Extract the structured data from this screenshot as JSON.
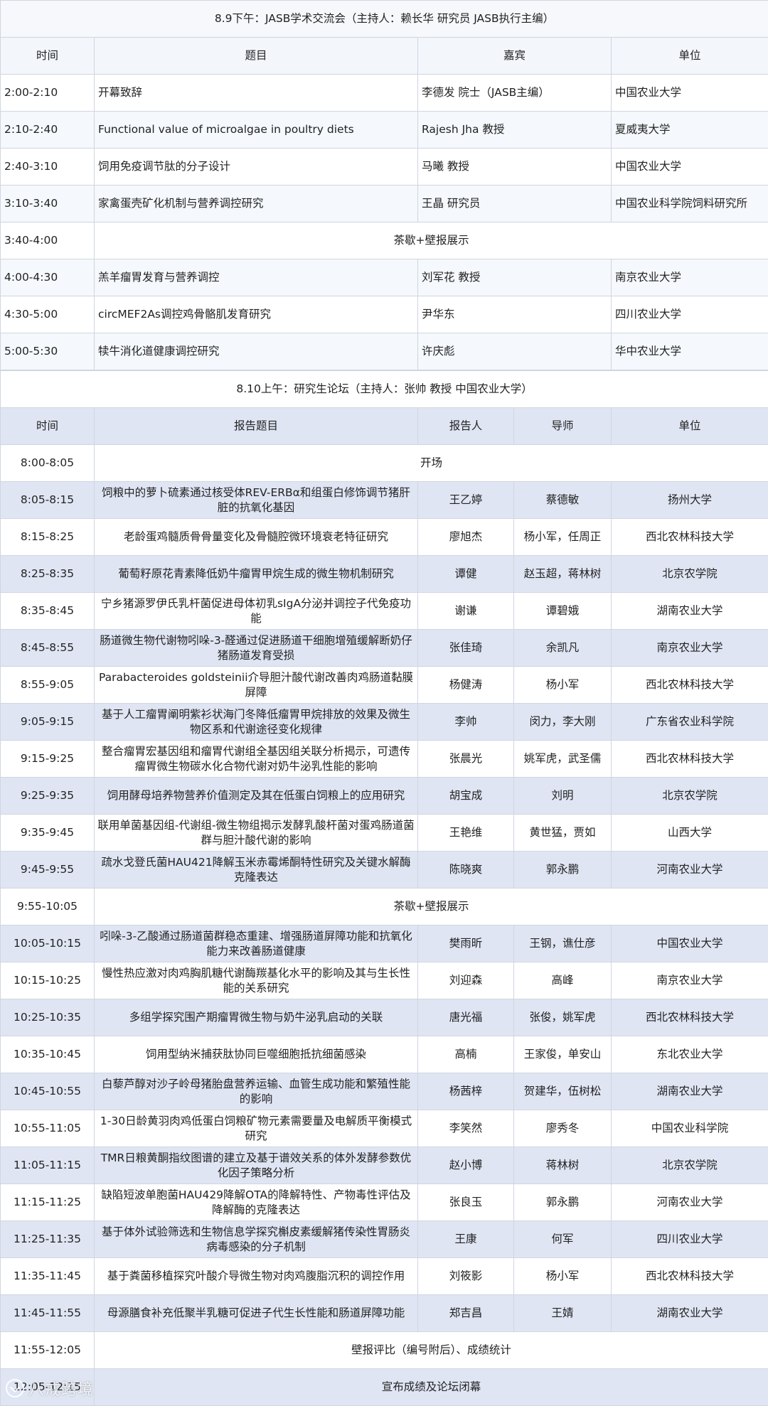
{
  "session1": {
    "title": "8.9下午：JASB学术交流会（主持人：赖长华  研究员 JASB执行主编）",
    "headers": {
      "time": "时间",
      "topic": "题目",
      "guest": "嘉宾",
      "unit": "单位"
    },
    "rows": [
      {
        "time": "2:00-2:10",
        "topic": "开幕致辞",
        "guest": "李德发 院士（JASB主编）",
        "unit": "中国农业大学"
      },
      {
        "time": "2:10-2:40",
        "topic": "Functional value of microalgae in poultry diets",
        "guest": "Rajesh Jha 教授",
        "unit": "夏威夷大学"
      },
      {
        "time": "2:40-3:10",
        "topic": "饲用免疫调节肽的分子设计",
        "guest": "马曦 教授",
        "unit": "中国农业大学"
      },
      {
        "time": "3:10-3:40",
        "topic": "家禽蛋壳矿化机制与营养调控研究",
        "guest": "王晶 研究员",
        "unit": "中国农业科学院饲料研究所"
      },
      {
        "time": "3:40-4:00",
        "break": "茶歇+壁报展示"
      },
      {
        "time": "4:00-4:30",
        "topic": "羔羊瘤胃发育与营养调控",
        "guest": "刘军花 教授",
        "unit": "南京农业大学"
      },
      {
        "time": "4:30-5:00",
        "topic": "circMEF2As调控鸡骨骼肌发育研究",
        "guest": "尹华东",
        "unit": "四川农业大学"
      },
      {
        "time": "5:00-5:30",
        "topic": "犊牛消化道健康调控研究",
        "guest": "许庆彪",
        "unit": "华中农业大学"
      }
    ]
  },
  "session2": {
    "title": "8.10上午：研究生论坛（主持人：张帅  教授 中国农业大学）",
    "headers": {
      "time": "时间",
      "topic": "报告题目",
      "speaker": "报告人",
      "advisor": "导师",
      "unit": "单位"
    },
    "rows": [
      {
        "time": "8:00-8:05",
        "span": "开场"
      },
      {
        "time": "8:05-8:15",
        "topic": "饲粮中的萝卜硫素通过核受体REV-ERBα和组蛋白修饰调节猪肝脏的抗氧化基因",
        "speaker": "王乙婷",
        "advisor": "蔡德敏",
        "unit": "扬州大学"
      },
      {
        "time": "8:15-8:25",
        "topic": "老龄蛋鸡髓质骨骨量变化及骨髓腔微环境衰老特征研究",
        "speaker": "廖旭杰",
        "advisor": "杨小军，任周正",
        "unit": "西北农林科技大学"
      },
      {
        "time": "8:25-8:35",
        "topic": "葡萄籽原花青素降低奶牛瘤胃甲烷生成的微生物机制研究",
        "speaker": "谭健",
        "advisor": "赵玉超，蒋林树",
        "unit": "北京农学院"
      },
      {
        "time": "8:35-8:45",
        "topic": "宁乡猪源罗伊氏乳杆菌促进母体初乳sIgA分泌并调控子代免疫功能",
        "speaker": "谢谦",
        "advisor": "谭碧娥",
        "unit": "湖南农业大学"
      },
      {
        "time": "8:45-8:55",
        "topic": "肠道微生物代谢物吲哚-3-醛通过促进肠道干细胞增殖缓解断奶仔猪肠道发育受损",
        "speaker": "张佳琦",
        "advisor": "余凯凡",
        "unit": "南京农业大学"
      },
      {
        "time": "8:55-9:05",
        "topic": "Parabacteroides goldsteinii介导胆汁酸代谢改善肉鸡肠道黏膜屏障",
        "speaker": "杨健涛",
        "advisor": "杨小军",
        "unit": "西北农林科技大学"
      },
      {
        "time": "9:05-9:15",
        "topic": "基于人工瘤胃阐明紫衫状海门冬降低瘤胃甲烷排放的效果及微生物区系和代谢途径变化规律",
        "speaker": "李帅",
        "advisor": "闵力，李大刚",
        "unit": "广东省农业科学院"
      },
      {
        "time": "9:15-9:25",
        "topic": "整合瘤胃宏基因组和瘤胃代谢组全基因组关联分析揭示，可遗传瘤胃微生物碳水化合物代谢对奶牛泌乳性能的影响",
        "speaker": "张晨光",
        "advisor": "姚军虎，武圣儒",
        "unit": "西北农林科技大学"
      },
      {
        "time": "9:25-9:35",
        "topic": "饲用酵母培养物营养价值测定及其在低蛋白饲粮上的应用研究",
        "speaker": "胡宝成",
        "advisor": "刘明",
        "unit": "北京农学院"
      },
      {
        "time": "9:35-9:45",
        "topic": "联用单菌基因组-代谢组-微生物组揭示发酵乳酸杆菌对蛋鸡肠道菌群与胆汁酸代谢的影响",
        "speaker": "王艳维",
        "advisor": "黄世猛，贾如",
        "unit": "山西大学"
      },
      {
        "time": "9:45-9:55",
        "topic": "疏水戈登氏菌HAU421降解玉米赤霉烯酮特性研究及关键水解酶克隆表达",
        "speaker": "陈晓爽",
        "advisor": "郭永鹏",
        "unit": "河南农业大学"
      },
      {
        "time": "9:55-10:05",
        "span": "茶歇+壁报展示"
      },
      {
        "time": "10:05-10:15",
        "topic": "吲哚-3-乙酸通过肠道菌群稳态重建、增强肠道屏障功能和抗氧化能力来改善肠道健康",
        "speaker": "樊雨昕",
        "advisor": "王钢，谯仕彦",
        "unit": "中国农业大学"
      },
      {
        "time": "10:15-10:25",
        "topic": "慢性热应激对肉鸡胸肌糖代谢酶羰基化水平的影响及其与生长性能的关系研究",
        "speaker": "刘迎森",
        "advisor": "高峰",
        "unit": "南京农业大学"
      },
      {
        "time": "10:25-10:35",
        "topic": "多组学探究围产期瘤胃微生物与奶牛泌乳启动的关联",
        "speaker": "唐光福",
        "advisor": "张俊，姚军虎",
        "unit": "西北农林科技大学"
      },
      {
        "time": "10:35-10:45",
        "topic": "饲用型纳米捕获肽协同巨噬细胞抵抗细菌感染",
        "speaker": "高楠",
        "advisor": "王家俊，单安山",
        "unit": "东北农业大学"
      },
      {
        "time": "10:45-10:55",
        "topic": "白藜芦醇对沙子岭母猪胎盘营养运输、血管生成功能和繁殖性能的影响",
        "speaker": "杨茜梓",
        "advisor": "贺建华，伍树松",
        "unit": "湖南农业大学"
      },
      {
        "time": "10:55-11:05",
        "topic": "1-30日龄黄羽肉鸡低蛋白饲粮矿物元素需要量及电解质平衡模式研究",
        "speaker": "李笑然",
        "advisor": "廖秀冬",
        "unit": "中国农业科学院"
      },
      {
        "time": "11:05-11:15",
        "topic": "TMR日粮黄酮指纹图谱的建立及基于谱效关系的体外发酵参数优化因子策略分析",
        "speaker": "赵小博",
        "advisor": "蒋林树",
        "unit": "北京农学院"
      },
      {
        "time": "11:15-11:25",
        "topic": "缺陷短波单胞菌HAU429降解OTA的降解特性、产物毒性评估及降解酶的克隆表达",
        "speaker": "张良玉",
        "advisor": "郭永鹏",
        "unit": "河南农业大学"
      },
      {
        "time": "11:25-11:35",
        "topic": "基于体外试验筛选和生物信息学探究槲皮素缓解猪传染性胃肠炎病毒感染的分子机制",
        "speaker": "王康",
        "advisor": "何军",
        "unit": "四川农业大学"
      },
      {
        "time": "11:35-11:45",
        "topic": "基于粪菌移植探究叶酸介导微生物对肉鸡腹脂沉积的调控作用",
        "speaker": "刘筱影",
        "advisor": "杨小军",
        "unit": "西北农林科技大学"
      },
      {
        "time": "11:45-11:55",
        "topic": "母源膳食补充低聚半乳糖可促进子代生长性能和肠道屏障功能",
        "speaker": "郑吉昌",
        "advisor": "王婧",
        "unit": "湖南农业大学"
      },
      {
        "time": "11:55-12:05",
        "span": "壁报评比（编号附后）、成绩统计"
      },
      {
        "time": "12:05-12:15",
        "span": "宣布成绩及论坛闭幕"
      }
    ]
  },
  "watermark": {
    "text": "八戒跨境",
    "icon": "watermark-logo-icon"
  }
}
